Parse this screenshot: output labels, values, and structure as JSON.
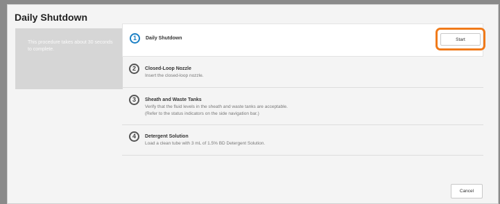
{
  "dialog": {
    "title": "Daily Shutdown"
  },
  "info": {
    "text": "This procedure takes about 30 seconds to complete."
  },
  "steps": [
    {
      "number": "1",
      "title": "Daily Shutdown",
      "lines": []
    },
    {
      "number": "2",
      "title": "Closed-Loop Nozzle",
      "lines": [
        "Insert the closed-loop nozzle."
      ]
    },
    {
      "number": "3",
      "title": "Sheath and Waste Tanks",
      "lines": [
        "Verify that the fluid levels in the sheath and waste tanks are acceptable.",
        "(Refer to the status indicators on the side navigation bar.)"
      ]
    },
    {
      "number": "4",
      "title": "Detergent Solution",
      "lines": [
        "Load a clean tube with 3 mL of 1.5% BD Detergent Solution."
      ]
    }
  ],
  "buttons": {
    "start": "Start",
    "cancel": "Cancel"
  },
  "colors": {
    "accent": "#1a7fc4",
    "highlight": "#f07a1a"
  }
}
